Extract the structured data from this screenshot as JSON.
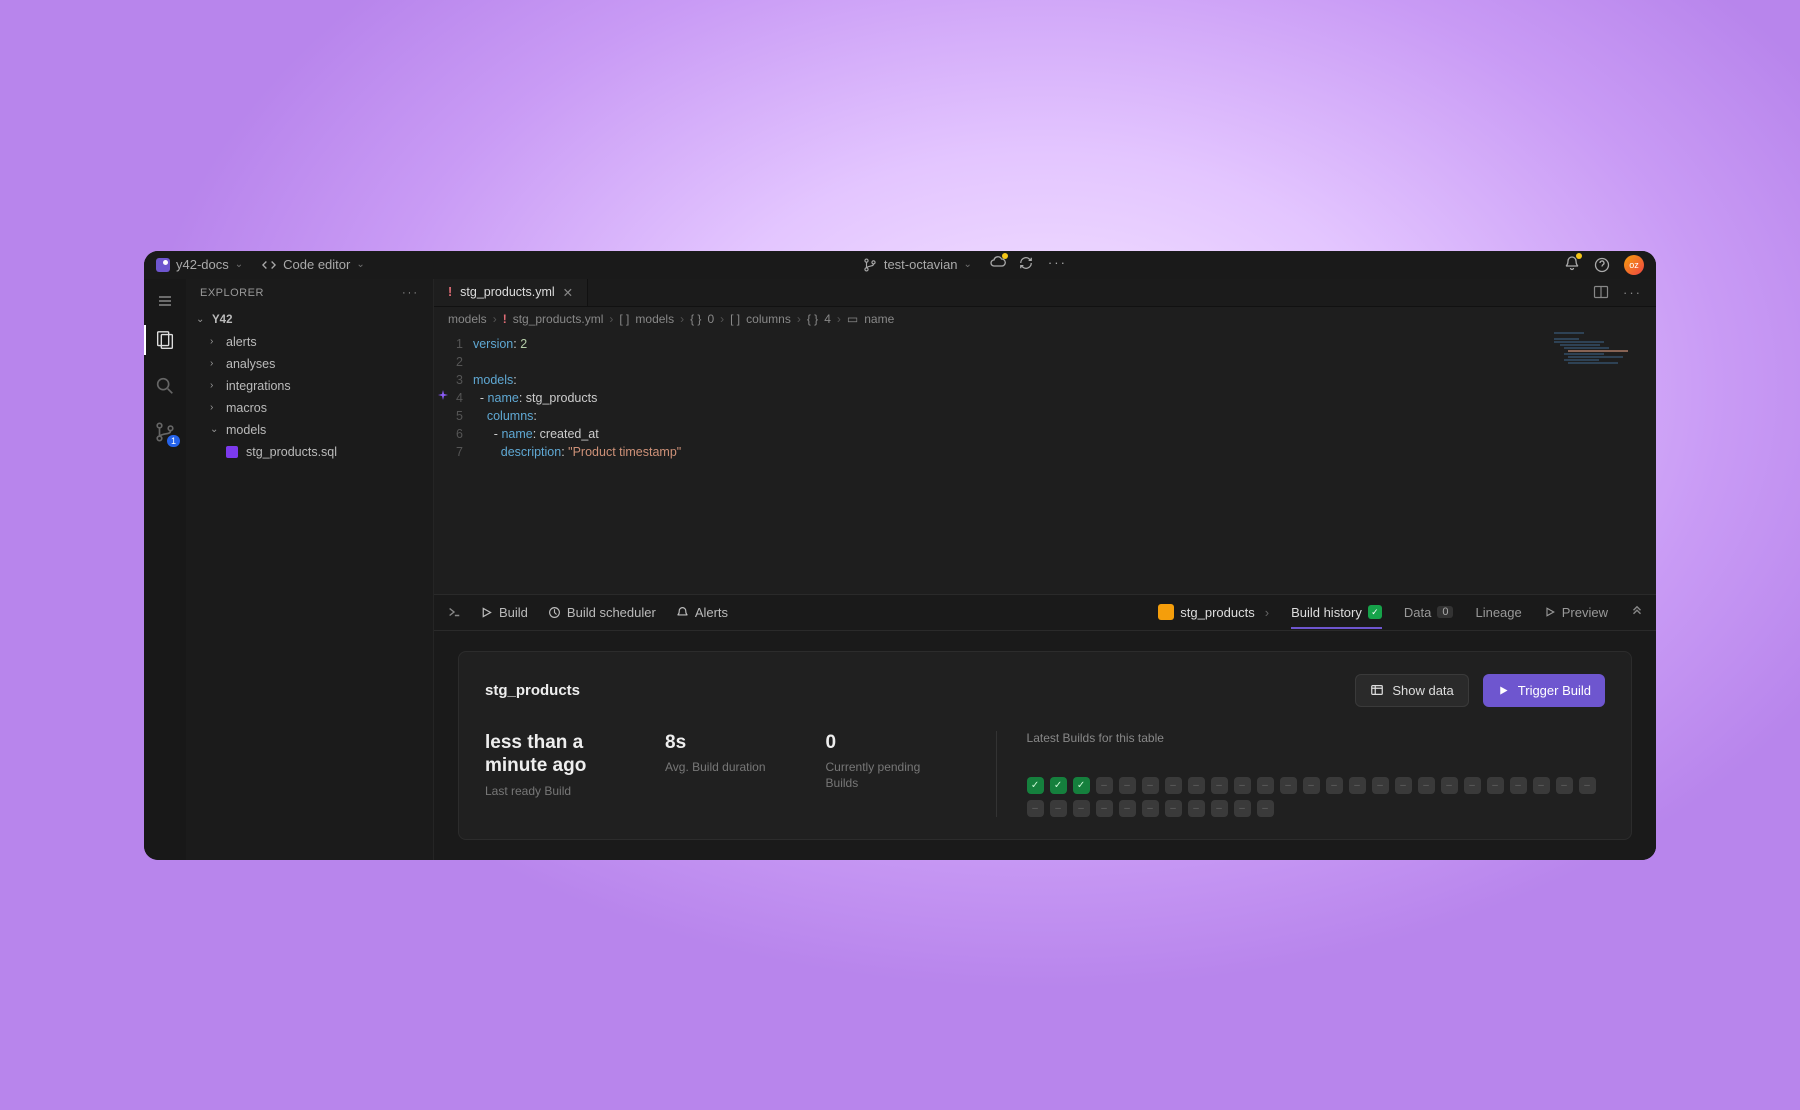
{
  "titlebar": {
    "workspace": "y42-docs",
    "mode": "Code editor",
    "branch": "test-octavian",
    "avatar_initials": "oz"
  },
  "sidebar": {
    "header": "EXPLORER",
    "root": "Y42",
    "folders": [
      "alerts",
      "analyses",
      "integrations",
      "macros",
      "models"
    ],
    "file": "stg_products.sql"
  },
  "tab": {
    "filename": "stg_products.yml"
  },
  "breadcrumb": {
    "seg0": "models",
    "seg1": "stg_products.yml",
    "seg2": "models",
    "seg3": "0",
    "seg4": "columns",
    "seg5": "4",
    "seg6": "name"
  },
  "code": {
    "l1": "version: 2",
    "l2": "",
    "l3": "models:",
    "l4": "  - name: stg_products",
    "l5": "    columns:",
    "l6": "      - name: created_at",
    "l7": "        description: \"Product timestamp\""
  },
  "bottom_tabs": {
    "build": "Build",
    "scheduler": "Build scheduler",
    "alerts": "Alerts",
    "asset": "stg_products",
    "history": "Build history",
    "data": "Data",
    "data_count": "0",
    "lineage": "Lineage",
    "preview": "Preview"
  },
  "card": {
    "title": "stg_products",
    "show_data": "Show data",
    "trigger": "Trigger Build",
    "stats": [
      {
        "value": "less than a minute ago",
        "label": "Last ready Build"
      },
      {
        "value": "8s",
        "label": "Avg. Build duration"
      },
      {
        "value": "0",
        "label": "Currently pending Builds"
      }
    ],
    "builds_label": "Latest Builds for this table",
    "builds": [
      "ok",
      "ok",
      "ok",
      "e",
      "e",
      "e",
      "e",
      "e",
      "e",
      "e",
      "e",
      "e",
      "e",
      "e",
      "e",
      "e",
      "e",
      "e",
      "e",
      "e",
      "e",
      "e",
      "e",
      "e",
      "e",
      "e",
      "e",
      "e",
      "e",
      "e",
      "e",
      "e",
      "e",
      "e",
      "e",
      "e"
    ]
  }
}
